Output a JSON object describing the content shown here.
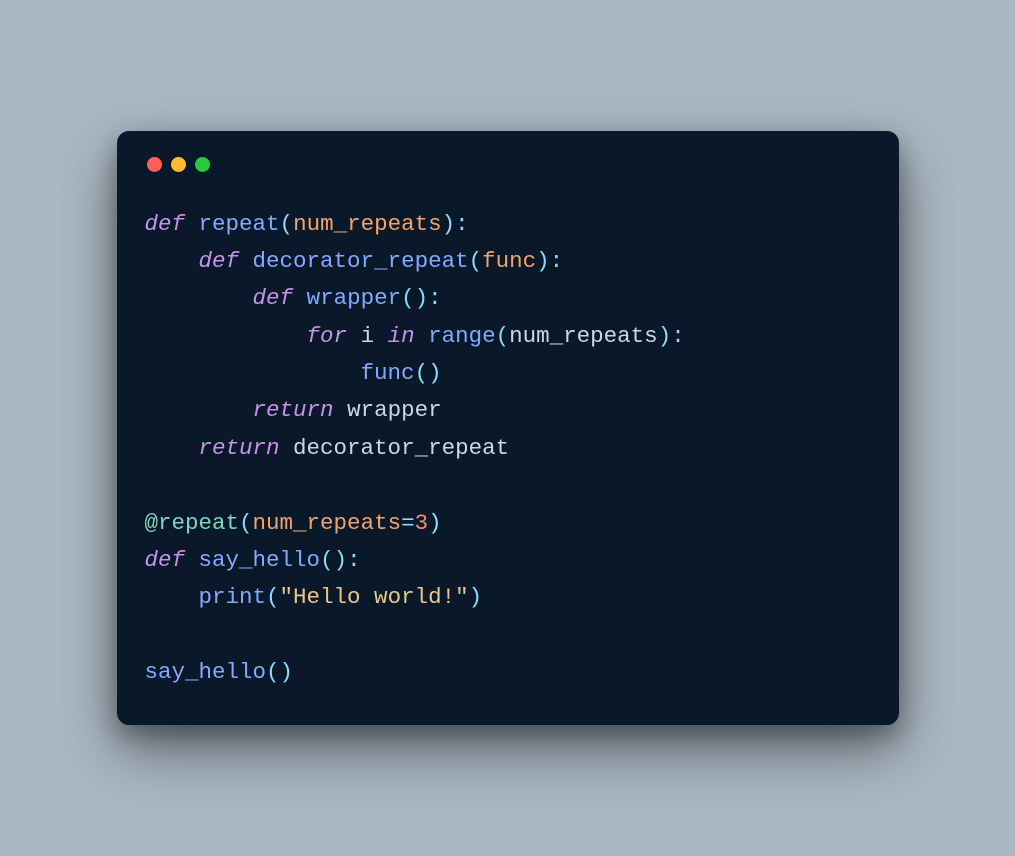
{
  "window": {
    "traffic_lights": [
      "red",
      "yellow",
      "green"
    ]
  },
  "code": {
    "language": "python",
    "tokens": {
      "def": "def",
      "for": "for",
      "in": "in",
      "return": "return",
      "repeat": "repeat",
      "decorator_repeat": "decorator_repeat",
      "wrapper": "wrapper",
      "func": "func",
      "range": "range",
      "num_repeats": "num_repeats",
      "i": "i",
      "say_hello": "say_hello",
      "print": "print",
      "hello_str": "\"Hello world!\"",
      "three": "3",
      "at": "@",
      "open_p": "(",
      "close_p": ")",
      "colon": ":",
      "eq": "="
    }
  }
}
